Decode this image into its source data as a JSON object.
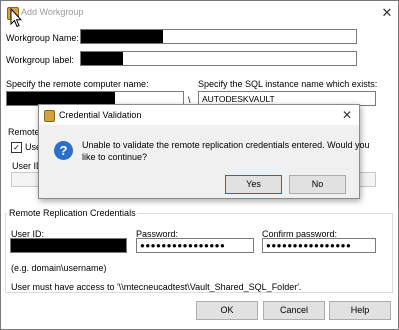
{
  "window": {
    "title": "Add Workgroup",
    "close_glyph": "✕"
  },
  "form": {
    "workgroup_name_label": "Workgroup Name:",
    "workgroup_label_label": "Workgroup label:",
    "remote_computer_label": "Specify the remote computer name:",
    "separator": "\\",
    "sql_instance_label": "Specify the SQL instance name which exists:",
    "sql_instance_value": "AUTODESKVAULT"
  },
  "background_partial": {
    "remote_section_label_partial": "Remote",
    "use_checkbox_label_partial": "Use",
    "user_id_partial": "User ID:"
  },
  "replication": {
    "legend": "Remote Replication Credentials",
    "user_id_label": "User ID:",
    "password_label": "Password:",
    "password_value": "●●●●●●●●●●●●●●●●",
    "confirm_label": "Confirm password:",
    "confirm_value": "●●●●●●●●●●●●●●●●",
    "hint": "(e.g. domain\\username)",
    "access_note": "User must have access to '\\\\mtecneucadtest\\Vault_Shared_SQL_Folder'."
  },
  "buttons": {
    "ok": "OK",
    "cancel": "Cancel",
    "help": "Help"
  },
  "dialog": {
    "title": "Credential Validation",
    "close_glyph": "✕",
    "icon_glyph": "?",
    "message_line1": "Unable to validate the remote replication credentials entered.  Would you",
    "message_line2": "like to continue?",
    "yes": "Yes",
    "no": "No"
  }
}
